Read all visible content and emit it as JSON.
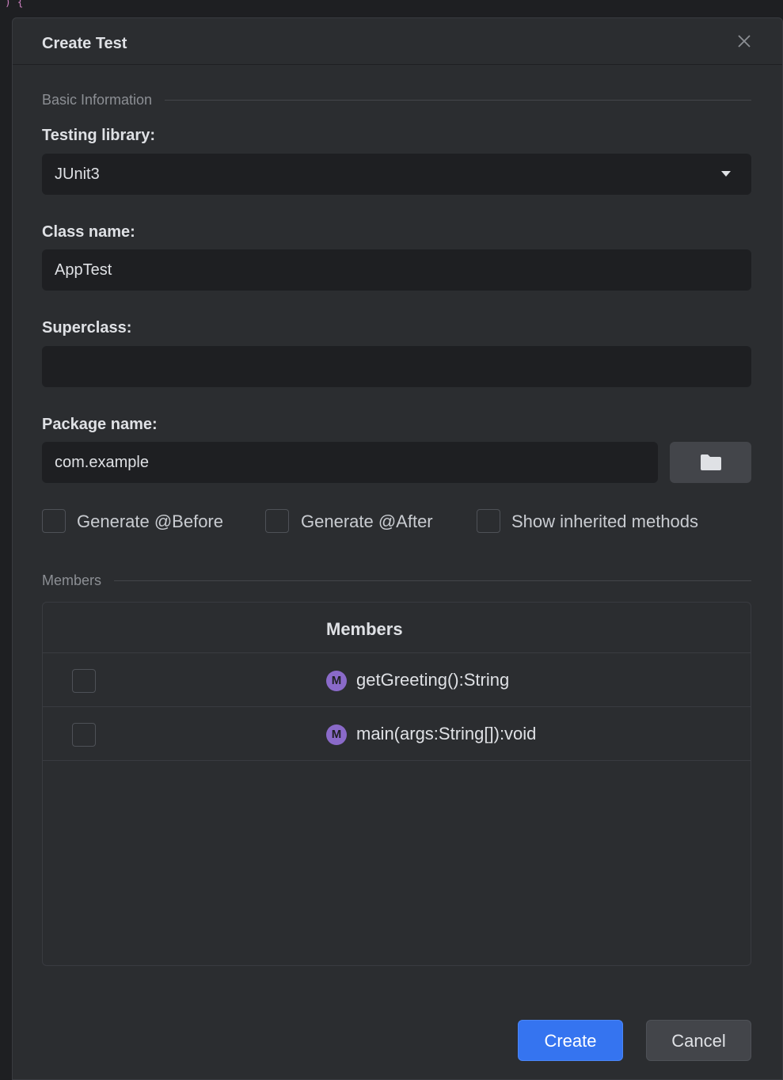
{
  "editor": {
    "glyph": ") {"
  },
  "dialog": {
    "title": "Create Test",
    "close_icon": "close-icon"
  },
  "basic_section": {
    "label": "Basic Information"
  },
  "testing_library": {
    "label": "Testing library:",
    "selected": "JUnit3"
  },
  "class_name": {
    "label": "Class name:",
    "value": "AppTest"
  },
  "superclass": {
    "label": "Superclass:",
    "value": ""
  },
  "package_name": {
    "label": "Package name:",
    "value": "com.example",
    "browse_icon": "folder-icon"
  },
  "options": {
    "generate_before": {
      "label": "Generate @Before",
      "checked": false
    },
    "generate_after": {
      "label": "Generate @After",
      "checked": false
    },
    "show_inherited": {
      "label": "Show inherited methods",
      "checked": false
    }
  },
  "members_section": {
    "label": "Members"
  },
  "members_table": {
    "header": "Members",
    "rows": [
      {
        "icon_letter": "M",
        "name": "getGreeting():String",
        "checked": false
      },
      {
        "icon_letter": "M",
        "name": "main(args:String[]):void",
        "checked": false
      }
    ]
  },
  "buttons": {
    "create": "Create",
    "cancel": "Cancel"
  },
  "colors": {
    "accent": "#3574f0",
    "method_icon": "#8a6ac9",
    "dialog_bg": "#2b2d30",
    "field_bg": "#1e1f22"
  }
}
